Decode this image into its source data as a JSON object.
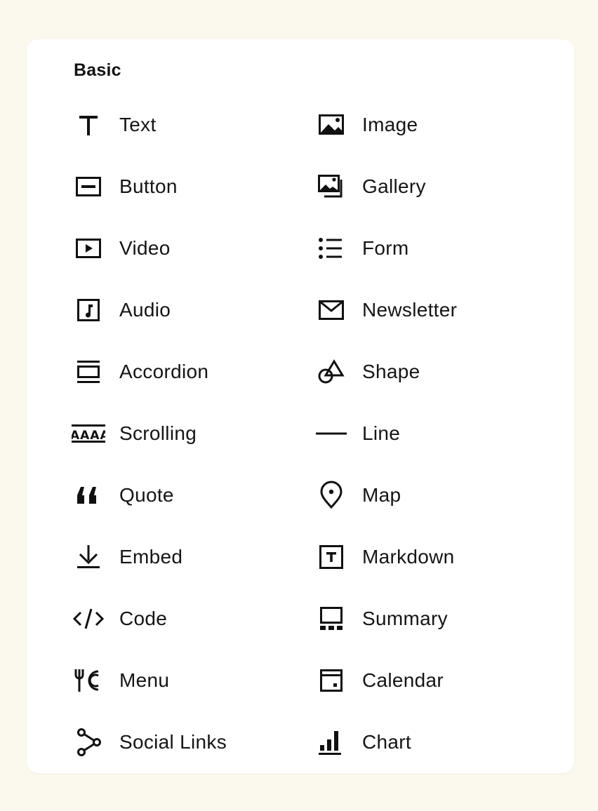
{
  "section": {
    "title": "Basic"
  },
  "items": [
    {
      "label": "Text",
      "icon": "text-icon"
    },
    {
      "label": "Image",
      "icon": "image-icon"
    },
    {
      "label": "Button",
      "icon": "button-icon"
    },
    {
      "label": "Gallery",
      "icon": "gallery-icon"
    },
    {
      "label": "Video",
      "icon": "video-icon"
    },
    {
      "label": "Form",
      "icon": "form-icon"
    },
    {
      "label": "Audio",
      "icon": "audio-icon"
    },
    {
      "label": "Newsletter",
      "icon": "newsletter-icon"
    },
    {
      "label": "Accordion",
      "icon": "accordion-icon"
    },
    {
      "label": "Shape",
      "icon": "shape-icon"
    },
    {
      "label": "Scrolling",
      "icon": "scrolling-icon"
    },
    {
      "label": "Line",
      "icon": "line-icon"
    },
    {
      "label": "Quote",
      "icon": "quote-icon"
    },
    {
      "label": "Map",
      "icon": "map-pin-icon"
    },
    {
      "label": "Embed",
      "icon": "embed-icon"
    },
    {
      "label": "Markdown",
      "icon": "markdown-icon"
    },
    {
      "label": "Code",
      "icon": "code-icon"
    },
    {
      "label": "Summary",
      "icon": "summary-icon"
    },
    {
      "label": "Menu",
      "icon": "menu-icon"
    },
    {
      "label": "Calendar",
      "icon": "calendar-icon"
    },
    {
      "label": "Social Links",
      "icon": "social-links-icon"
    },
    {
      "label": "Chart",
      "icon": "chart-icon"
    }
  ],
  "colors": {
    "background": "#fbf8ee",
    "panel": "#ffffff",
    "ink": "#111111"
  }
}
